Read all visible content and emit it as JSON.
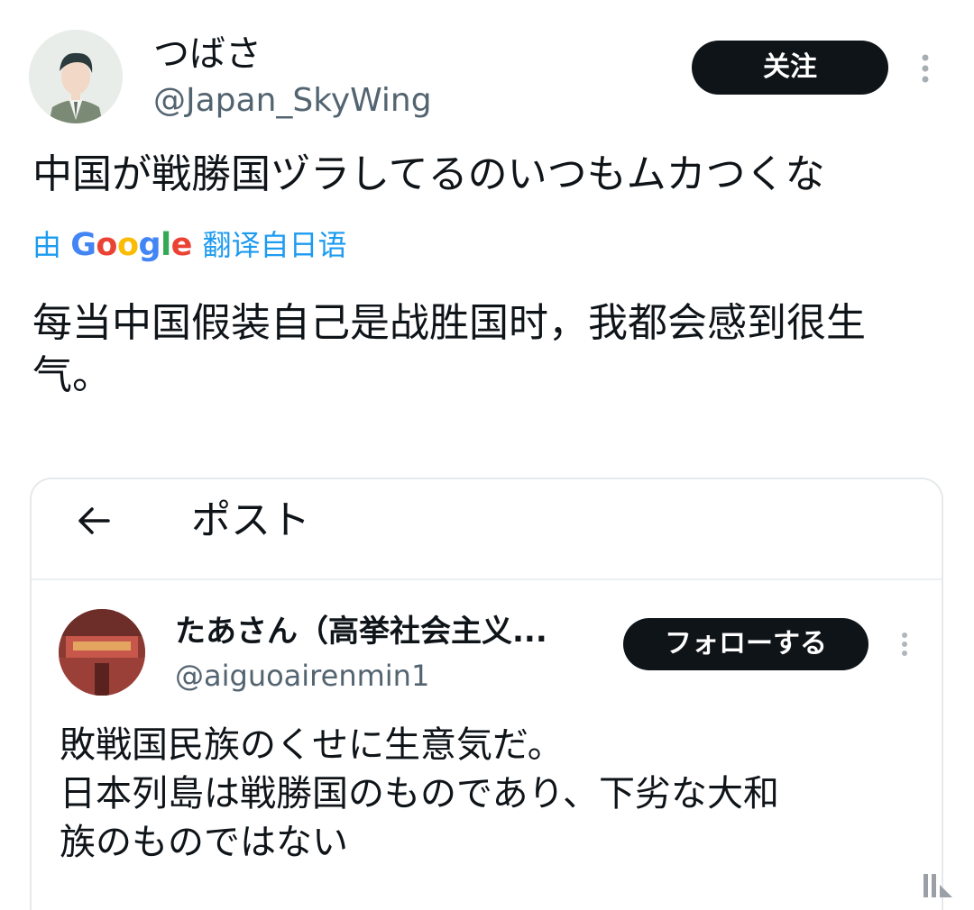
{
  "tweet": {
    "display_name": "つばさ",
    "handle": "@Japan_SkyWing",
    "follow_label": "关注",
    "text": "中国が戦勝国ヅラしてるのいつもムカつくな",
    "translate": {
      "prefix": "由",
      "brand": "Google",
      "suffix": "翻译自日语"
    },
    "translation": "每当中国假装自己是战胜国时，我都会感到很生气。"
  },
  "embedded_post": {
    "header_title": "ポスト",
    "display_name": "たあさん（高挙社会主义...",
    "handle": "@aiguoairenmin1",
    "follow_label": "フォローする",
    "text_lines": [
      "敗戦国民族のくせに生意気だ。",
      "日本列島は戦勝国のものであり、下劣な大和",
      "族のものではない"
    ]
  },
  "icons": {
    "more": "more-vertical-icon",
    "back": "arrow-left-icon"
  },
  "colors": {
    "text": "#0f1419",
    "secondary": "#536471",
    "link": "#1d9bf0",
    "button_bg": "#0f1419"
  }
}
